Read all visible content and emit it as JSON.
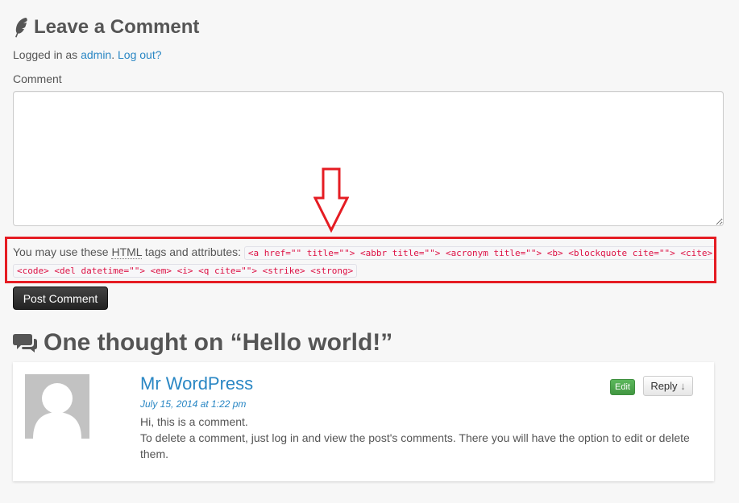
{
  "respond": {
    "title": "Leave a Comment",
    "title_icon": "feather-icon",
    "logged_in_prefix": "Logged in as ",
    "username": "admin",
    "logged_in_sep": ". ",
    "logout_label": "Log out?",
    "comment_label": "Comment",
    "comment_value": "",
    "allowed_tags_prefix": "You may use these ",
    "allowed_tags_abbr": "HTML",
    "allowed_tags_suffix": " tags and attributes: ",
    "allowed_tags_code": "<a href=\"\" title=\"\"> <abbr title=\"\"> <acronym title=\"\"> <b> <blockquote cite=\"\"> <cite> <code> <del datetime=\"\"> <em> <i> <q cite=\"\"> <strike> <strong>",
    "submit_label": "Post Comment"
  },
  "annotation": {
    "arrow_icon": "down-arrow-annotation",
    "highlight_color": "#e51c23"
  },
  "comments": {
    "heading": "One thought on “Hello world!”",
    "heading_icon": "chat-bubbles-icon",
    "items": [
      {
        "author": "Mr WordPress",
        "date": "July 15, 2014 at 1:22 pm",
        "lines": [
          "Hi, this is a comment.",
          "To delete a comment, just log in and view the post's comments. There you will have the option to edit or delete them."
        ],
        "edit_label": "Edit",
        "reply_label": "Reply",
        "reply_arrow": "↓"
      }
    ]
  },
  "colors": {
    "link": "#2a87c4",
    "edit_button": "#4cae4c",
    "code_text": "#dd1144",
    "annotation_red": "#e51c23"
  }
}
